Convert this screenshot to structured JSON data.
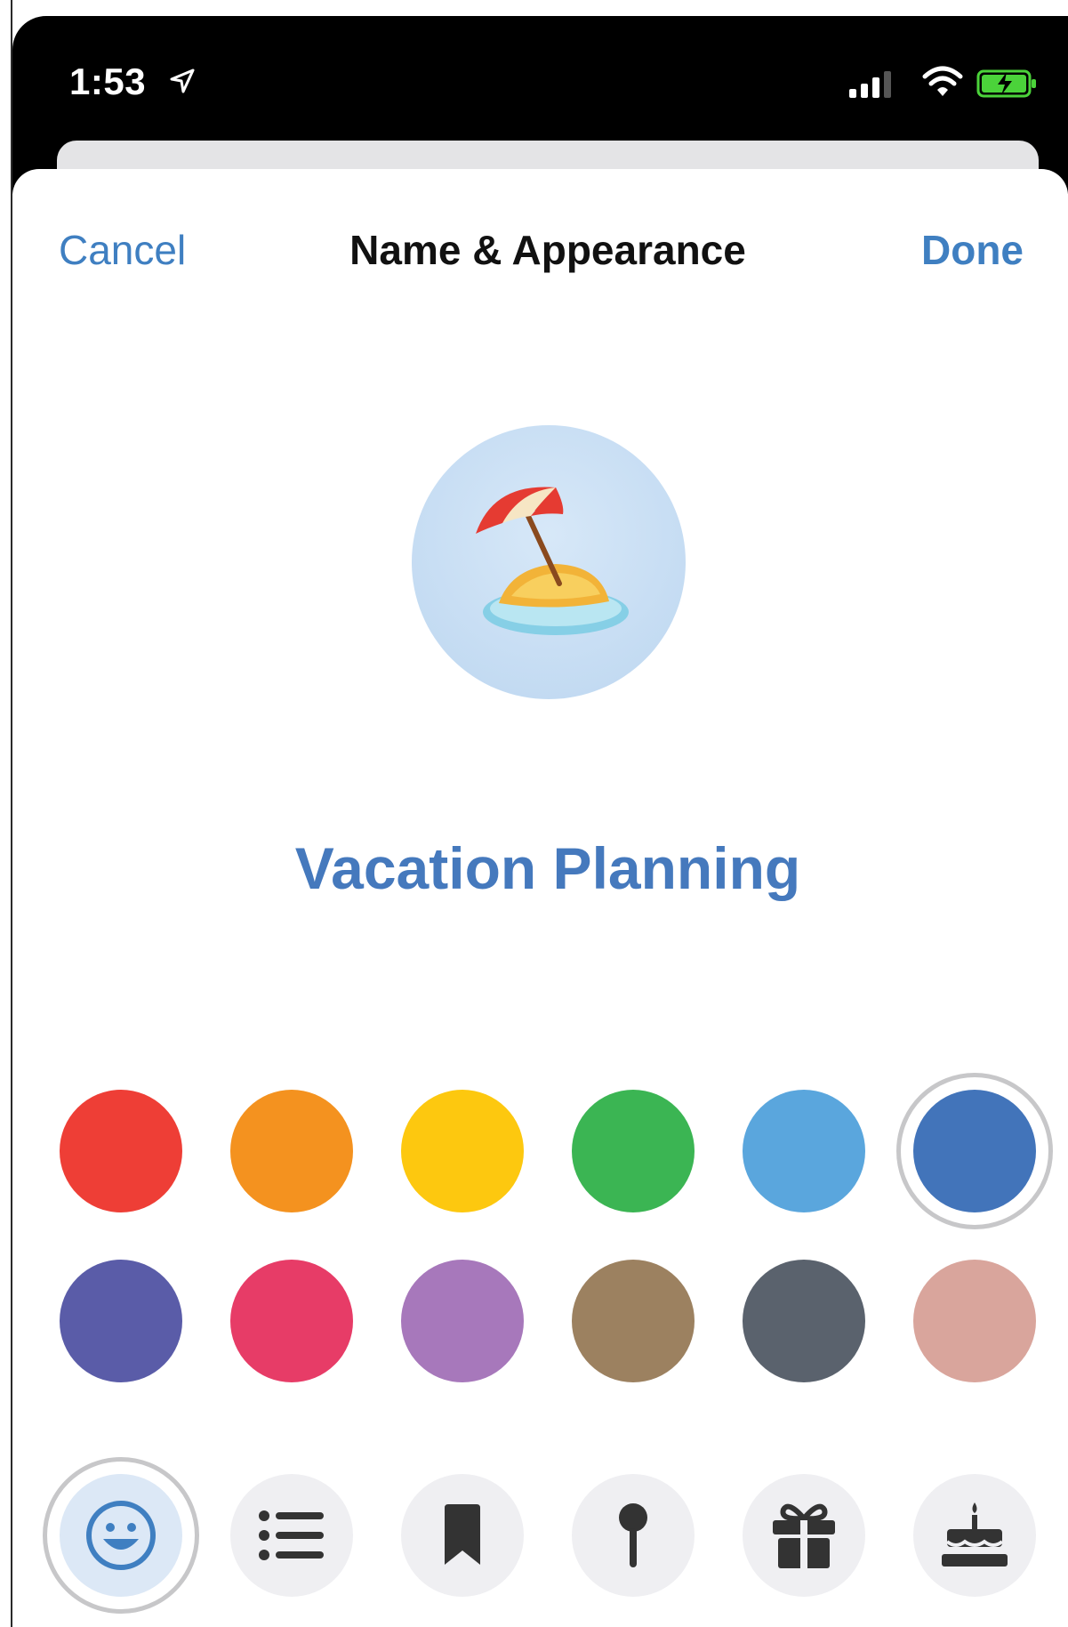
{
  "status_bar": {
    "time": "1:53"
  },
  "nav": {
    "cancel_label": "Cancel",
    "title": "Name & Appearance",
    "done_label": "Done"
  },
  "list": {
    "name": "Vacation Planning",
    "icon": "beach-umbrella-emoji"
  },
  "colors": {
    "selected": "#4274ba",
    "row1": [
      "#ee3e36",
      "#f4921f",
      "#fdc80f",
      "#3bb553",
      "#5aa6dd",
      "#4274ba"
    ],
    "row2": [
      "#5a5ca8",
      "#e73c67",
      "#a778bb",
      "#9c8160",
      "#5a626d",
      "#d9a59c"
    ]
  },
  "icons": [
    "smiley-icon",
    "list-icon",
    "bookmark-icon",
    "pin-icon",
    "gift-icon",
    "cake-icon"
  ]
}
